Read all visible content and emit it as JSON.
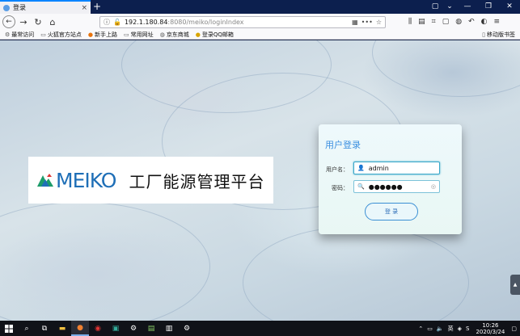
{
  "browser": {
    "tab_title": "登录",
    "tab_close": "×",
    "new_tab": "+",
    "window_controls": [
      "—",
      "❐",
      "✕"
    ],
    "url_host": "192.1.180.84",
    "url_path": ":8080/meiko/loginIndex"
  },
  "bookmarks": [
    {
      "label": "最常访问",
      "icon": "gear-icon"
    },
    {
      "label": "火狐官方站点",
      "icon": "folder-icon"
    },
    {
      "label": "新手上路",
      "icon": "firefox-icon"
    },
    {
      "label": "常用网址",
      "icon": "folder-icon"
    },
    {
      "label": "京东商城",
      "icon": "globe-icon"
    },
    {
      "label": "登录QQ邮箱",
      "icon": "qq-icon"
    }
  ],
  "mobile_bookmarks": "移动版书签",
  "brand": {
    "logo_text": "MEIKO",
    "subtitle": "工厂能源管理平台",
    "logo_color": "#1f6fb7"
  },
  "login": {
    "title": "用户登录",
    "username_label": "用户名：",
    "username_value": "admin",
    "password_label": "密码：",
    "password_value": "●●●●●●",
    "submit_label": "登 录",
    "accent_color": "#3b8fe0"
  },
  "taskbar": {
    "ime": "英",
    "time": "10:26",
    "date": "2020/3/24"
  }
}
